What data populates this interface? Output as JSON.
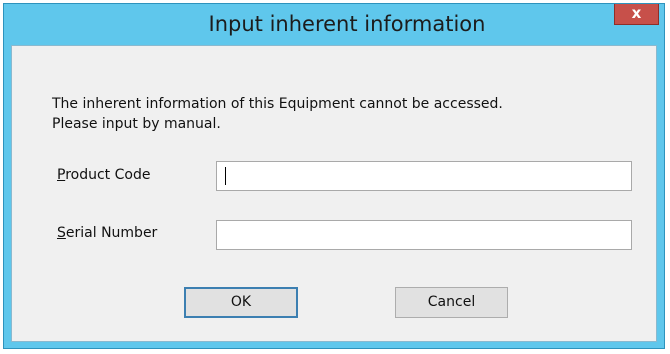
{
  "window": {
    "title": "Input inherent information",
    "close_label": "x"
  },
  "message": {
    "line1": "The inherent information of this Equipment cannot be accessed.",
    "line2": "Please input by manual."
  },
  "fields": {
    "product_code": {
      "label_underlined": "P",
      "label_rest": "roduct Code",
      "value": ""
    },
    "serial_number": {
      "label_underlined": "S",
      "label_rest": "erial Number",
      "value": ""
    }
  },
  "buttons": {
    "ok_label": "OK",
    "cancel_label": "Cancel"
  },
  "colors": {
    "titlebar": "#5fc7ec",
    "close_button": "#c7504a",
    "client_bg": "#f0f0f0"
  }
}
